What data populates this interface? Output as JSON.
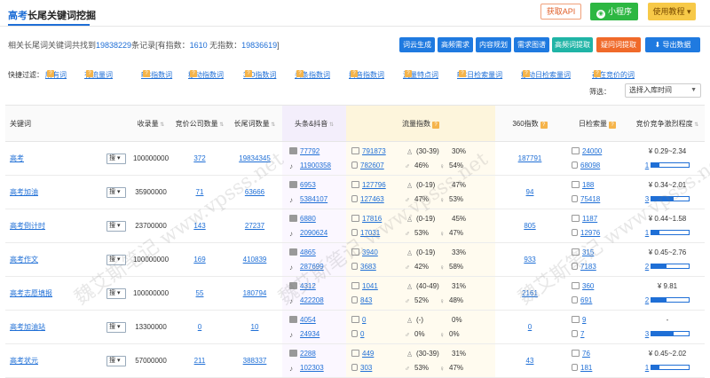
{
  "header": {
    "title_hl": "高考",
    "title_rest": "长尾关键词挖掘",
    "api_label": "获取API",
    "mini_label": "小程序",
    "tutorial_label": "使用教程 ▾"
  },
  "summary": {
    "prefix": "相关长尾词关键词共找到",
    "total": "19838229",
    "mid1": "条记录[有指数：",
    "with_index": "1610",
    "mid2": " 无指数：",
    "without_index": "19836619",
    "suffix": "]"
  },
  "tools": [
    {
      "label": "词云生成",
      "color": "#1f7ae0"
    },
    {
      "label": "高频需求",
      "color": "#1f7ae0"
    },
    {
      "label": "内容规划",
      "color": "#1f7ae0"
    },
    {
      "label": "需求图谱",
      "color": "#1f7ae0"
    },
    {
      "label": "高频词提取",
      "color": "#1fb4a6"
    },
    {
      "label": "疑问词提取",
      "color": "#f06a2a"
    },
    {
      "label": "导出数据",
      "color": "#1f7ae0"
    }
  ],
  "filters": {
    "label": "快捷过滤：",
    "items": [
      "所有词",
      "有流量词",
      "PC指数词",
      "移动指数词",
      "360指数词",
      "头条指数词",
      "抖音指数词",
      "流量特点词",
      "PC日检索量词",
      "移动日检索量词",
      "存在竞价的词"
    ]
  },
  "screen": {
    "label": "筛选：",
    "value": "选择入库时间"
  },
  "columns": [
    "关键词",
    "收录量",
    "竞价公司数量",
    "长尾词数量",
    "头条&抖音",
    "流量指数",
    "360指数",
    "日检索量",
    "竞价竞争激烈程度"
  ],
  "rows": [
    {
      "kw": "高考",
      "sou": "搜",
      "shoulu": "100000000",
      "jingjia": "372",
      "changwei": "19834345",
      "tt": "77792",
      "dy": "11900358",
      "pc": "791873",
      "mo": "782607",
      "age": "(30-39)",
      "man": "30%",
      "male": "46%",
      "female": "54%",
      "s360": "187791",
      "rpc": "24000",
      "rmo": "68098",
      "price": "¥ 0.29~2.34",
      "level": "1",
      "fill": 0.2
    },
    {
      "kw": "高考加油",
      "sou": "搜",
      "shoulu": "35900000",
      "jingjia": "71",
      "changwei": "63666",
      "tt": "6953",
      "dy": "5384107",
      "pc": "127796",
      "mo": "127463",
      "age": "(0-19)",
      "man": "47%",
      "male": "47%",
      "female": "53%",
      "s360": "94",
      "rpc": "188",
      "rmo": "75418",
      "price": "¥ 0.34~2.01",
      "level": "3",
      "fill": 0.6
    },
    {
      "kw": "高考倒计时",
      "sou": "搜",
      "shoulu": "23700000",
      "jingjia": "143",
      "changwei": "27237",
      "tt": "6880",
      "dy": "2090624",
      "pc": "17816",
      "mo": "17031",
      "age": "(0-19)",
      "man": "45%",
      "male": "53%",
      "female": "47%",
      "s360": "805",
      "rpc": "1187",
      "rmo": "12976",
      "price": "¥ 0.44~1.58",
      "level": "1",
      "fill": 0.2
    },
    {
      "kw": "高考作文",
      "sou": "搜",
      "shoulu": "100000000",
      "jingjia": "169",
      "changwei": "410839",
      "tt": "4865",
      "dy": "287699",
      "pc": "3940",
      "mo": "3683",
      "age": "(0-19)",
      "man": "33%",
      "male": "42%",
      "female": "58%",
      "s360": "933",
      "rpc": "315",
      "rmo": "7183",
      "price": "¥ 0.45~2.76",
      "level": "2",
      "fill": 0.4
    },
    {
      "kw": "高考志愿填报",
      "sou": "搜",
      "shoulu": "100000000",
      "jingjia": "55",
      "changwei": "180794",
      "tt": "4312",
      "dy": "422208",
      "pc": "1041",
      "mo": "843",
      "age": "(40-49)",
      "man": "31%",
      "male": "52%",
      "female": "48%",
      "s360": "2161",
      "rpc": "360",
      "rmo": "691",
      "price": "¥ 9.81",
      "level": "2",
      "fill": 0.4
    },
    {
      "kw": "高考加油站",
      "sou": "搜",
      "shoulu": "13300000",
      "jingjia": "0",
      "changwei": "10",
      "tt": "4054",
      "dy": "24934",
      "pc": "0",
      "mo": "0",
      "age": "(-)",
      "man": "0%",
      "male": "0%",
      "female": "0%",
      "s360": "0",
      "rpc": "9",
      "rmo": "7",
      "price": "-",
      "level": "3",
      "fill": 0.6
    },
    {
      "kw": "高考状元",
      "sou": "搜",
      "shoulu": "57000000",
      "jingjia": "211",
      "changwei": "388337",
      "tt": "2288",
      "dy": "102303",
      "pc": "449",
      "mo": "303",
      "age": "(30-39)",
      "man": "31%",
      "male": "53%",
      "female": "47%",
      "s360": "43",
      "rpc": "76",
      "rmo": "181",
      "price": "¥ 0.45~2.02",
      "level": "1",
      "fill": 0.2
    }
  ],
  "watermark": "魏艾斯笔记 www.vpsss.net"
}
